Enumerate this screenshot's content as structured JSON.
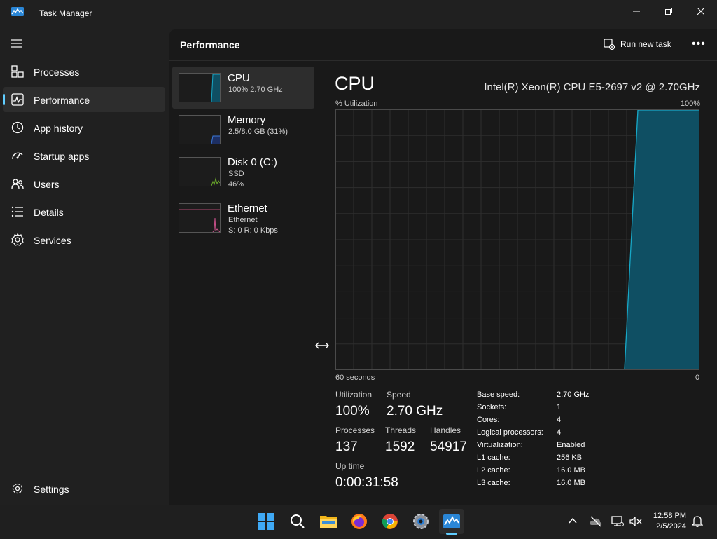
{
  "window": {
    "title": "Task Manager"
  },
  "nav": {
    "items": [
      {
        "label": "Processes",
        "icon": "processes-icon"
      },
      {
        "label": "Performance",
        "icon": "performance-icon",
        "active": true
      },
      {
        "label": "App history",
        "icon": "app-history-icon"
      },
      {
        "label": "Startup apps",
        "icon": "startup-apps-icon"
      },
      {
        "label": "Users",
        "icon": "users-icon"
      },
      {
        "label": "Details",
        "icon": "details-icon"
      },
      {
        "label": "Services",
        "icon": "services-icon"
      }
    ],
    "settings_label": "Settings"
  },
  "header": {
    "title": "Performance",
    "run_task_label": "Run new task",
    "more_label": "•••"
  },
  "devices": [
    {
      "name": "CPU",
      "sub1": "100%  2.70 GHz",
      "sub2": ""
    },
    {
      "name": "Memory",
      "sub1": "2.5/8.0 GB (31%)",
      "sub2": ""
    },
    {
      "name": "Disk 0 (C:)",
      "sub1": "SSD",
      "sub2": "46%"
    },
    {
      "name": "Ethernet",
      "sub1": "Ethernet",
      "sub2": "S: 0  R: 0 Kbps"
    }
  ],
  "detail": {
    "title": "CPU",
    "model": "Intel(R) Xeon(R) CPU E5-2697 v2 @ 2.70GHz",
    "graph_label_left": "% Utilization",
    "graph_label_right": "100%",
    "graph_bottom_left": "60 seconds",
    "graph_bottom_right": "0",
    "stats": {
      "utilization_label": "Utilization",
      "utilization": "100%",
      "speed_label": "Speed",
      "speed": "2.70 GHz",
      "processes_label": "Processes",
      "processes": "137",
      "threads_label": "Threads",
      "threads": "1592",
      "handles_label": "Handles",
      "handles": "54917",
      "uptime_label": "Up time",
      "uptime": "0:00:31:58"
    },
    "specs": [
      {
        "k": "Base speed:",
        "v": "2.70 GHz"
      },
      {
        "k": "Sockets:",
        "v": "1"
      },
      {
        "k": "Cores:",
        "v": "4"
      },
      {
        "k": "Logical processors:",
        "v": "4"
      },
      {
        "k": "Virtualization:",
        "v": "Enabled"
      },
      {
        "k": "L1 cache:",
        "v": "256 KB"
      },
      {
        "k": "L2 cache:",
        "v": "16.0 MB"
      },
      {
        "k": "L3 cache:",
        "v": "16.0 MB"
      }
    ]
  },
  "taskbar": {
    "time": "12:58 PM",
    "date": "2/5/2024"
  },
  "colors": {
    "accent": "#60cdff",
    "cpu_line": "#17a8c7",
    "cpu_fill": "#0f4f63"
  }
}
